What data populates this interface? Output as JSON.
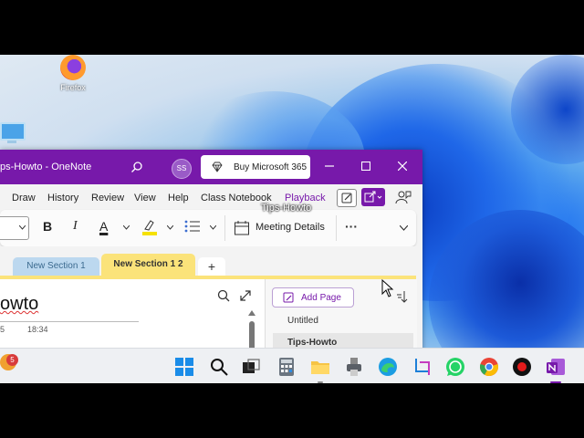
{
  "desktop": {
    "icons": [
      {
        "label": "Firefox"
      }
    ]
  },
  "window": {
    "title": "ps-Howto  -  OneNote",
    "avatar_initials": "SS",
    "buy_label": "Buy Microsoft 365",
    "accent": "#7719aa"
  },
  "menu": {
    "items": [
      "Draw",
      "History",
      "Review",
      "View",
      "Help",
      "Class Notebook",
      "Playback"
    ]
  },
  "ribbon": {
    "bold": "B",
    "italic": "I",
    "font_color": "A",
    "more": "···",
    "meeting_details": "Meeting Details",
    "caption_overlay": "Tips-Howto"
  },
  "sections": {
    "tabs": [
      "New Section 1",
      "New Section 1 2"
    ],
    "add": "+",
    "active_color": "#fbe37a",
    "inactive_color": "#bcd8ef"
  },
  "page": {
    "title": "owto",
    "date": "5",
    "time": "18:34"
  },
  "pages_pane": {
    "add_page": "Add Page",
    "items": [
      "Untitled",
      "Tips-Howto"
    ],
    "selected": "Tips-Howto"
  },
  "taskbar": {
    "notification_count": "5",
    "apps": [
      "start",
      "search",
      "task-view",
      "calculator",
      "file-explorer",
      "printer",
      "edge",
      "snipping-tool",
      "whatsapp",
      "chrome",
      "recorder",
      "onenote"
    ]
  }
}
